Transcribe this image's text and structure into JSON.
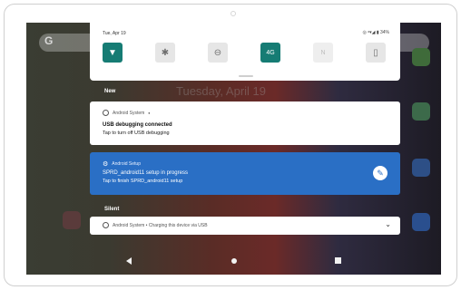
{
  "quick_settings": {
    "date": "Tue, Apr 19",
    "status": "◎ ᵃ▾◢ ▮ 34%",
    "tiles": [
      {
        "name": "wifi",
        "icon": "wifi-icon",
        "glyph": "▼",
        "state": "on"
      },
      {
        "name": "bluetooth",
        "icon": "bluetooth-icon",
        "glyph": "✱",
        "state": "off"
      },
      {
        "name": "do-not-disturb",
        "icon": "dnd-icon",
        "glyph": "⊖",
        "state": "off"
      },
      {
        "name": "mobile-data",
        "icon": "mobile-data-icon",
        "glyph": "4G",
        "state": "on"
      },
      {
        "name": "nfc",
        "icon": "nfc-icon",
        "glyph": "N",
        "state": "dim"
      },
      {
        "name": "flashlight",
        "icon": "flashlight-icon",
        "glyph": "▯",
        "state": "off"
      }
    ]
  },
  "background": {
    "ghost_date": "Tuesday, April 19"
  },
  "sections": {
    "new_label": "New",
    "silent_label": "Silent"
  },
  "notifications": {
    "usb": {
      "app": "Android System",
      "bell": "♦",
      "title": "USB debugging connected",
      "body": "Tap to turn off USB debugging"
    },
    "setup": {
      "app": "Android Setup",
      "title": "SPRD_android11 setup in progress",
      "body": "Tap to finish SPRD_android11 setup"
    },
    "silent": {
      "summary": "Android System • Charging this device via USB"
    }
  },
  "colors": {
    "accent_teal": "#167c74",
    "setup_blue": "#2a6fc5"
  }
}
